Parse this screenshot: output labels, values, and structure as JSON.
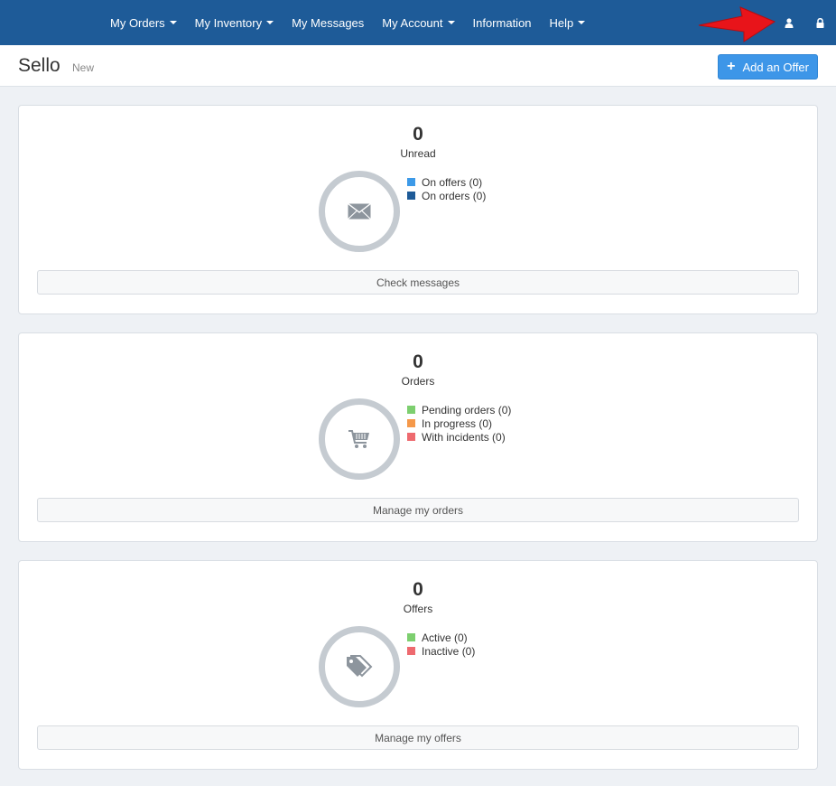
{
  "nav": {
    "items": [
      {
        "label": "My Orders",
        "dropdown": true
      },
      {
        "label": "My Inventory",
        "dropdown": true
      },
      {
        "label": "My Messages",
        "dropdown": false
      },
      {
        "label": "My Account",
        "dropdown": true
      },
      {
        "label": "Information",
        "dropdown": false
      },
      {
        "label": "Help",
        "dropdown": true
      }
    ]
  },
  "header": {
    "title": "Sello",
    "subtitle": "New",
    "add_offer_label": "Add an Offer"
  },
  "cards": {
    "messages": {
      "count": "0",
      "label": "Unread",
      "icon": "envelope-icon",
      "legend": [
        {
          "label": "On offers (0)",
          "color": "#3d9ae8"
        },
        {
          "label": "On orders (0)",
          "color": "#1e5b98"
        }
      ],
      "button": "Check messages"
    },
    "orders": {
      "count": "0",
      "label": "Orders",
      "icon": "cart-icon",
      "legend": [
        {
          "label": "Pending orders (0)",
          "color": "#7dcf6f"
        },
        {
          "label": "In progress (0)",
          "color": "#f5994a"
        },
        {
          "label": "With incidents (0)",
          "color": "#ee6a6f"
        }
      ],
      "button": "Manage my orders"
    },
    "offers": {
      "count": "0",
      "label": "Offers",
      "icon": "tags-icon",
      "legend": [
        {
          "label": "Active (0)",
          "color": "#7dcf6f"
        },
        {
          "label": "Inactive (0)",
          "color": "#ee6a6f"
        }
      ],
      "button": "Manage my offers"
    }
  },
  "colors": {
    "navbar": "#1e5b98",
    "primary_button": "#3d96e8",
    "ring": "#c5cbd1",
    "arrow": "#e8141a"
  }
}
